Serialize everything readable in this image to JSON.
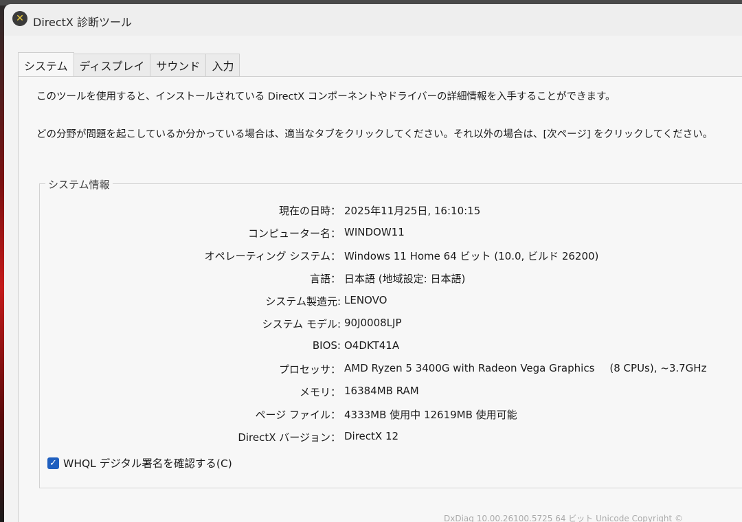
{
  "window": {
    "title": "DirectX 診断ツール",
    "icon": "directx-icon"
  },
  "tabs": [
    {
      "label": "システム",
      "active": true
    },
    {
      "label": "ディスプレイ",
      "active": false
    },
    {
      "label": "サウンド",
      "active": false
    },
    {
      "label": "入力",
      "active": false
    }
  ],
  "description": {
    "line1": "このツールを使用すると、インストールされている DirectX コンポーネントやドライバーの詳細情報を入手することができます。",
    "line2": "どの分野が問題を起こしているか分かっている場合は、適当なタブをクリックしてください。それ以外の場合は、[次ページ] をクリックしてください。"
  },
  "system_info": {
    "group_label": "システム情報",
    "rows": [
      {
        "label": "現在の日時：",
        "value": "2025年11月25日, 16:10:15"
      },
      {
        "label": "コンピューター名：",
        "value": "WINDOW11"
      },
      {
        "label": "オペレーティング システム：",
        "value": "Windows 11 Home 64 ビット (10.0, ビルド 26200)"
      },
      {
        "label": "言語：",
        "value": "日本語 (地域設定: 日本語)"
      },
      {
        "label": "システム製造元:",
        "value": "LENOVO"
      },
      {
        "label": "システム モデル:",
        "value": "90J0008LJP"
      },
      {
        "label": "BIOS:",
        "value": "O4DKT41A"
      },
      {
        "label": "プロセッサ：",
        "value": "AMD Ryzen 5 3400G with Radeon Vega Graphics",
        "extra": "(8 CPUs), ~3.7GHz"
      },
      {
        "label": "メモリ：",
        "value": "16384MB RAM"
      },
      {
        "label": "ページ ファイル：",
        "value": "4333MB 使用中 12619MB 使用可能"
      },
      {
        "label": "DirectX バージョン：",
        "value": "DirectX 12"
      }
    ]
  },
  "whql": {
    "label": "WHQL デジタル署名を確認する(C)",
    "checked": true
  },
  "bottom_partial_text": "DxDiag 10.00.26100.5725 64 ビット Unicode Copyright ©"
}
